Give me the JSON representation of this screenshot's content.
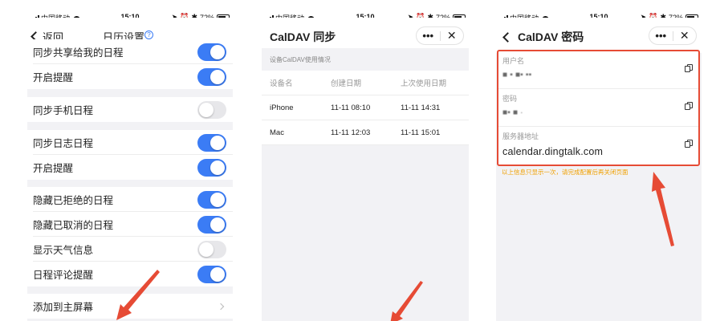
{
  "status": {
    "carrier": "中国移动",
    "time": "15:10",
    "battery": "72%",
    "battery_level": 0.72
  },
  "panel1": {
    "back_label": "返回",
    "title": "日历设置",
    "help_icon": "?",
    "rows": [
      {
        "label": "同步共享给我的日程",
        "toggle": true
      },
      {
        "label": "开启提醒",
        "toggle": true
      },
      {
        "label": "同步手机日程",
        "toggle": false
      },
      {
        "label": "同步日志日程",
        "toggle": true
      },
      {
        "label": "开启提醒",
        "toggle": true
      },
      {
        "label": "隐藏已拒绝的日程",
        "toggle": true
      },
      {
        "label": "隐藏已取消的日程",
        "toggle": true
      },
      {
        "label": "显示天气信息",
        "toggle": false
      },
      {
        "label": "日程评论提醒",
        "toggle": true
      },
      {
        "label": "添加到主屏幕",
        "toggle": null
      }
    ]
  },
  "panel2": {
    "title": "CalDAV 同步",
    "more": "•••",
    "close": "✕",
    "section": "设备CalDAV使用情况",
    "headers": [
      "设备名",
      "创建日期",
      "上次使用日期"
    ],
    "devices": [
      {
        "name": "iPhone",
        "created": "11-11 08:10",
        "last_used": "11-11 14:31"
      },
      {
        "name": "Mac",
        "created": "11-11 12:03",
        "last_used": "11-11 15:01"
      }
    ]
  },
  "panel3": {
    "title": "CalDAV 密码",
    "more": "•••",
    "close": "✕",
    "fields": [
      {
        "label": "用户名",
        "value": "■ ▪ ■▪ ▪▪",
        "masked": true
      },
      {
        "label": "密码",
        "value": "■▪ ■  ·",
        "masked": true
      },
      {
        "label": "服务器地址",
        "value": "calendar.dingtalk.com",
        "masked": false
      }
    ],
    "note": "以上信息只显示一次，请完成配置后再关闭页面"
  },
  "colors": {
    "accent": "#3b7cf5",
    "highlight": "#e64b35",
    "warning": "#f0a000"
  }
}
